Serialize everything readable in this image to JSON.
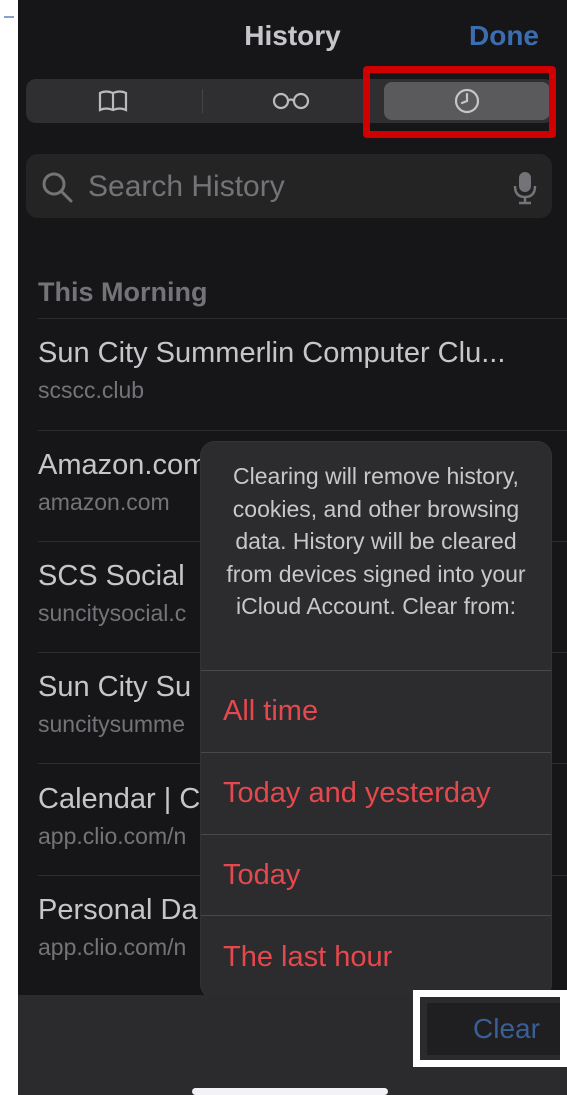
{
  "header": {
    "title": "History",
    "done_label": "Done"
  },
  "segments": [
    {
      "icon": "book-icon"
    },
    {
      "icon": "reading-list-glasses-icon"
    },
    {
      "icon": "history-clock-icon",
      "selected": true
    }
  ],
  "search": {
    "placeholder": "Search History",
    "icon": "search-icon",
    "mic_icon": "microphone-icon"
  },
  "section": {
    "title": "This Morning"
  },
  "history": [
    {
      "title": "Sun City Summerlin Computer Clu...",
      "url": "scscc.club"
    },
    {
      "title": "Amazon.com",
      "url": "amazon.com"
    },
    {
      "title": "SCS Social",
      "url": "suncitysocial.c"
    },
    {
      "title": "Sun City Su",
      "url": "suncitysumme"
    },
    {
      "title": "Calendar | C",
      "url": "app.clio.com/n"
    },
    {
      "title": "Personal Da",
      "url": "app.clio.com/n"
    }
  ],
  "clear_sheet": {
    "message": "Clearing will remove history, cookies, and other browsing data. History will be cleared from devices signed into your iCloud Account. Clear from:",
    "options": [
      "All time",
      "Today and yesterday",
      "Today",
      "The last hour"
    ]
  },
  "toolbar": {
    "clear_label": "Clear"
  },
  "colors": {
    "accent": "#4a86d8",
    "destructive": "#e5484d",
    "highlight": "#ff0000",
    "background": "#1c1c1e"
  }
}
